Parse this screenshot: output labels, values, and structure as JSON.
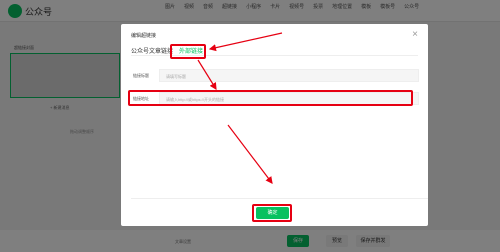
{
  "app": {
    "title": "公众号"
  },
  "toolbar": {
    "items": [
      "图片",
      "视频",
      "音频",
      "超链接",
      "小程序",
      "卡片",
      "视频号",
      "投票",
      "地理位置",
      "模板",
      "模板号",
      "公众号"
    ]
  },
  "left_panel": {
    "title": "超链接封面",
    "add_label": "+ 新建消息",
    "sub_label": "拖动调整顺序"
  },
  "modal": {
    "title": "编辑超链接",
    "close": "×",
    "tabs": [
      {
        "label": "公众号文章链接",
        "active": false
      },
      {
        "label": "外部链接",
        "active": true
      }
    ],
    "fields": [
      {
        "label": "链接标题",
        "placeholder": "请填写标题"
      },
      {
        "label": "链接地址",
        "placeholder": "请输入http://或https://开头的链接"
      }
    ],
    "confirm": "确定"
  },
  "bottom": {
    "left_text": "文章设置",
    "buttons": [
      "保存",
      "预览",
      "保存并群发"
    ]
  },
  "colors": {
    "accent": "#07c160",
    "highlight": "#e60012"
  }
}
